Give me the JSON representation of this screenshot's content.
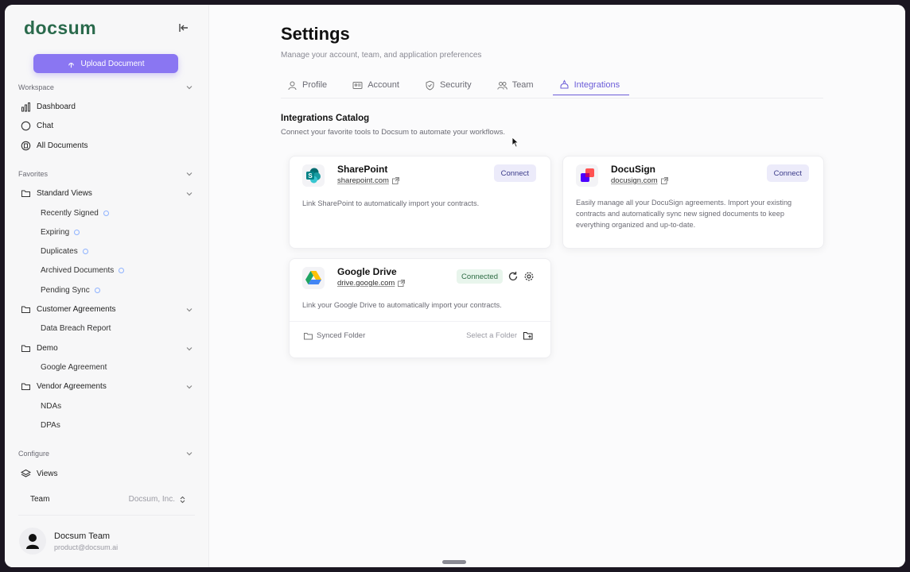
{
  "app": {
    "logo": "docsum"
  },
  "sidebar": {
    "upload_label": "Upload Document",
    "workspace_label": "Workspace",
    "workspace_items": [
      "Dashboard",
      "Chat",
      "All Documents"
    ],
    "favorites_label": "Favorites",
    "standard_views": {
      "label": "Standard Views",
      "items": [
        "Recently Signed",
        "Expiring",
        "Duplicates",
        "Archived Documents",
        "Pending Sync"
      ]
    },
    "customer_agreements": {
      "label": "Customer Agreements",
      "items": [
        "Data Breach Report"
      ]
    },
    "demo": {
      "label": "Demo",
      "items": [
        "Google Agreement"
      ]
    },
    "vendor_agreements": {
      "label": "Vendor Agreements",
      "items": [
        "NDAs",
        "DPAs"
      ]
    },
    "configure_label": "Configure",
    "views_label": "Views",
    "team_label": "Team",
    "team_value": "Docsum, Inc.",
    "user": {
      "name": "Docsum Team",
      "email": "product@docsum.ai"
    }
  },
  "settings": {
    "title": "Settings",
    "subtitle": "Manage your account, team, and application preferences",
    "tabs": [
      "Profile",
      "Account",
      "Security",
      "Team",
      "Integrations"
    ],
    "active_tab": "Integrations",
    "catalog_title": "Integrations Catalog",
    "catalog_subtitle": "Connect your favorite tools to Docsum to automate your workflows."
  },
  "integrations": {
    "sharepoint": {
      "name": "SharePoint",
      "link": "sharepoint.com",
      "button": "Connect",
      "desc": "Link SharePoint to automatically import your contracts."
    },
    "docusign": {
      "name": "DocuSign",
      "link": "docusign.com",
      "button": "Connect",
      "desc_1": "Easily manage all your DocuSign agreements. Import your existing",
      "desc_2": "contracts and automatically sync new signed documents to keep",
      "desc_3": "everything organized and up-to-date."
    },
    "gdrive": {
      "name": "Google Drive",
      "link": "drive.google.com",
      "status": "Connected",
      "desc": "Link your Google Drive to automatically import your contracts.",
      "synced_folder": "Synced Folder",
      "select_folder": "Select a Folder"
    }
  },
  "colors": {
    "accent": "#8a76f2",
    "tab_active": "#6b5cd8",
    "connected_bg": "#e8f5ec",
    "connect_bg": "#ecebfa"
  }
}
